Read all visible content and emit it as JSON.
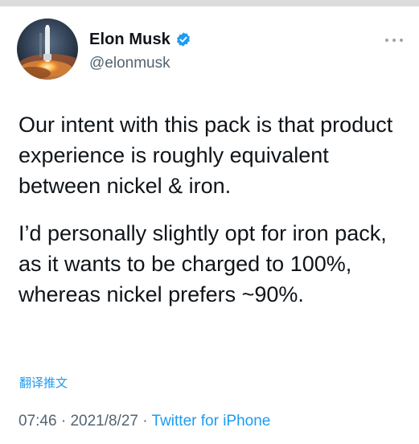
{
  "author": {
    "display_name": "Elon Musk",
    "handle": "@elonmusk",
    "verified": true,
    "avatar_icon": "rocket-launch-avatar"
  },
  "tweet": {
    "paragraphs": [
      "Our intent with this pack is that product experience is roughly equivalent between nickel & iron.",
      "I’d personally slightly opt for iron pack, as it wants to be charged to 100%, whereas nickel prefers ~90%."
    ],
    "translate_label": "翻译推文"
  },
  "meta": {
    "time": "07:46",
    "separator": "·",
    "date": "2021/8/27",
    "source": "Twitter for iPhone"
  },
  "colors": {
    "text": "#0f1419",
    "secondary": "#536471",
    "accent": "#1d9bf0"
  },
  "icons": {
    "verified": "verified-badge-icon",
    "more": "more-options-icon"
  }
}
